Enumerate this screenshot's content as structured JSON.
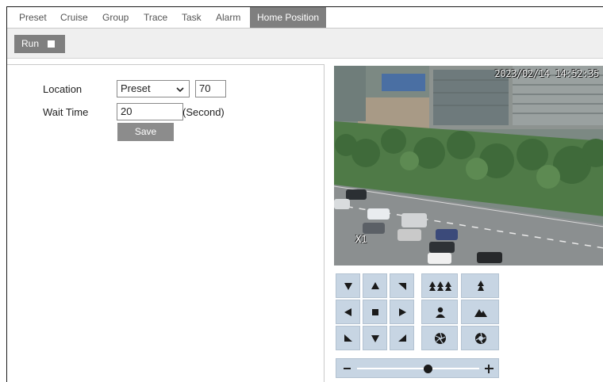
{
  "tabs": [
    {
      "label": "Preset"
    },
    {
      "label": "Cruise"
    },
    {
      "label": "Group"
    },
    {
      "label": "Trace"
    },
    {
      "label": "Task"
    },
    {
      "label": "Alarm"
    },
    {
      "label": "Home Position",
      "active": true
    }
  ],
  "toolbar": {
    "run_label": "Run",
    "run_checked": false
  },
  "form": {
    "location_label": "Location",
    "location_select": "Preset",
    "location_number": "70",
    "wait_label": "Wait Time",
    "wait_value": "20",
    "wait_unit": "(Second)",
    "save_label": "Save"
  },
  "video": {
    "timestamp": "2023/02/14 14:52:35",
    "zoom_label": "X1"
  },
  "ptz": {
    "icons": [
      "pan-down-left-icon",
      "tilt-up-icon",
      "pan-down-right-icon",
      "pan-left-icon",
      "stop-icon",
      "pan-right-icon",
      "pan-up-left-icon",
      "tilt-down-icon",
      "pan-up-right-icon",
      "zoom-out-icon",
      "zoom-in-icon",
      "focus-near-icon",
      "focus-far-icon",
      "iris-close-icon",
      "iris-open-icon"
    ],
    "zoom_level": 0.58
  },
  "colors": {
    "tab_active": "#7f7f7f",
    "ptz_button": "#c7d5e3",
    "toolbar_bg": "#efefef"
  }
}
